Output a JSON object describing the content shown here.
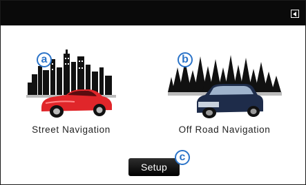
{
  "header": {
    "back_icon": "back-arrow-icon"
  },
  "options": [
    {
      "marker": "a",
      "label": "Street Navigation",
      "icon": "city-car-icon",
      "car_color": "#e0262a"
    },
    {
      "marker": "b",
      "label": "Off Road Navigation",
      "icon": "forest-suv-icon",
      "car_color": "#1e2c4a"
    }
  ],
  "setup": {
    "label": "Setup",
    "marker": "c"
  },
  "colors": {
    "marker": "#2a73c8",
    "topbar": "#0a0a0a"
  }
}
